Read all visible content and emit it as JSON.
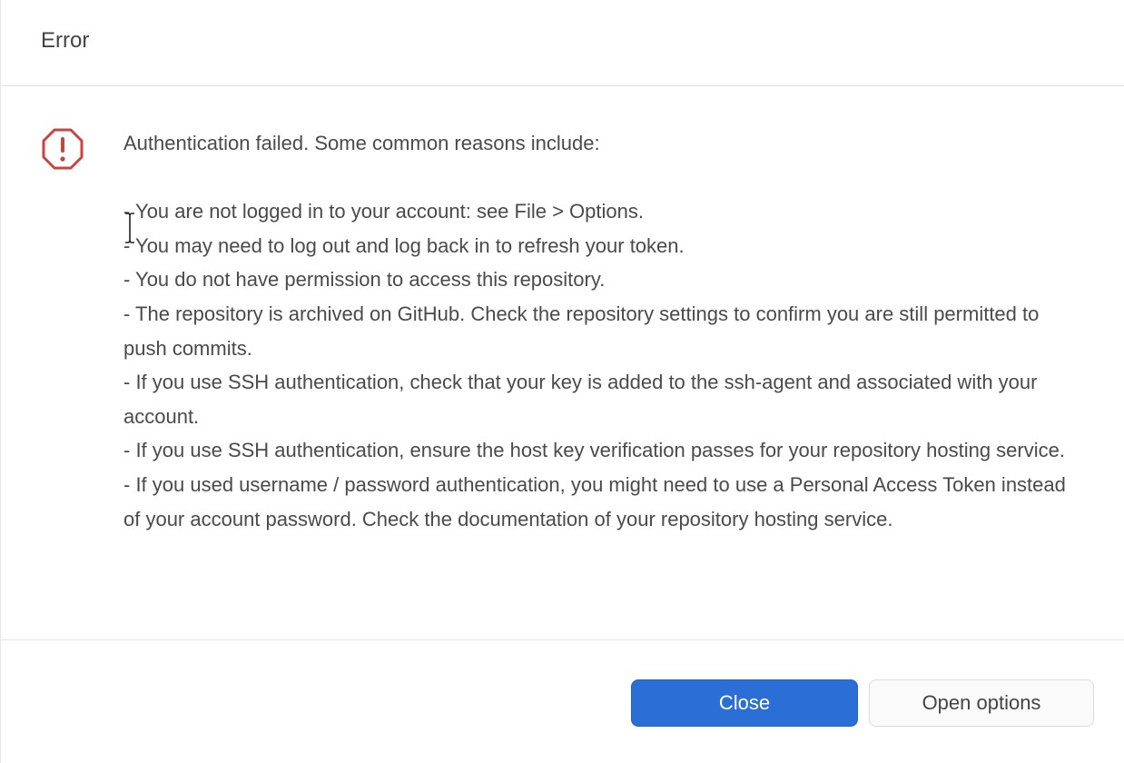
{
  "dialog": {
    "title": "Error",
    "icon": "error-octagon-icon",
    "message": {
      "intro": "Authentication failed. Some common reasons include:",
      "reasons": [
        "- You are not logged in to your account: see File > Options.",
        "- You may need to log out and log back in to refresh your token.",
        "- You do not have permission to access this repository.",
        "- The repository is archived on GitHub. Check the repository settings to confirm you are still permitted to push commits.",
        "- If you use SSH authentication, check that your key is added to the ssh-agent and associated with your account.",
        "- If you use SSH authentication, ensure the host key verification passes for your repository hosting service.",
        "- If you used username / password authentication, you might need to use a Personal Access Token instead of your account password. Check the documentation of your repository hosting service."
      ]
    },
    "buttons": {
      "close_label": "Close",
      "open_options_label": "Open options"
    }
  },
  "colors": {
    "primary_button": "#2b6fd6",
    "error_icon": "#c9433f"
  }
}
